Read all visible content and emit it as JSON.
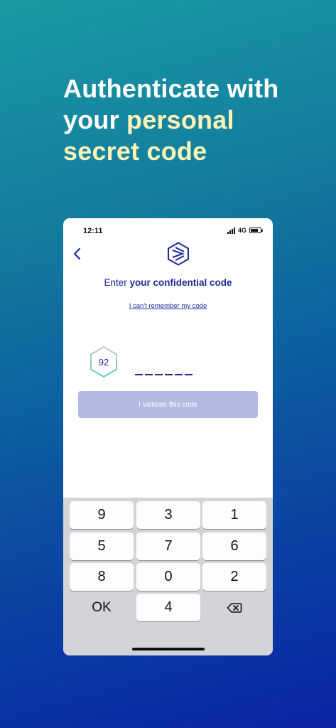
{
  "headline": {
    "line1": "Authenticate with",
    "line2_a": "your ",
    "line2_b": "personal",
    "line3": "secret code"
  },
  "status_bar": {
    "time": "12:11",
    "network": "4G"
  },
  "screen": {
    "title_prefix": "Enter ",
    "title_bold": "your confidential code",
    "forgot_link": "I can't remember my code",
    "badge_number": "92",
    "validate_label": "I validate this code"
  },
  "keypad": {
    "rows": [
      [
        "9",
        "3",
        "1"
      ],
      [
        "5",
        "7",
        "6"
      ],
      [
        "8",
        "0",
        "2"
      ],
      [
        "OK",
        "4",
        "⌫"
      ]
    ]
  },
  "colors": {
    "accent": "#1c2a9a",
    "highlight": "#fff3b8",
    "button_disabled": "#b4b9e3"
  }
}
